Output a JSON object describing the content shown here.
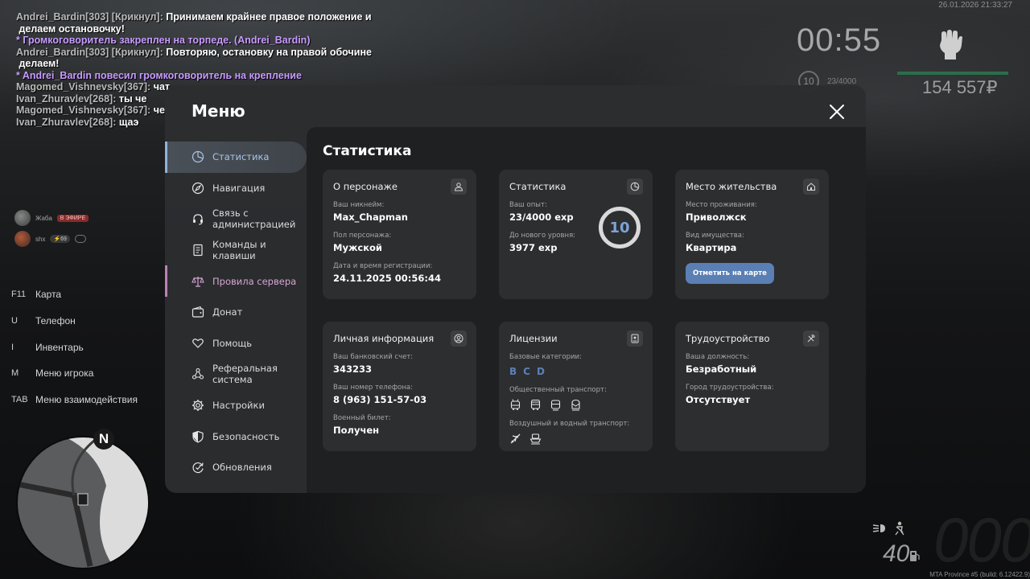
{
  "chat": [
    {
      "name": "Andrei_Bardin[303] [Крикнул]: ",
      "msg": "Принимаем крайнее правое положение и\n делаем остановочку!",
      "type": "msg"
    },
    {
      "name": "",
      "msg": "* Громкоговоритель закреплен на торпеде. (Andrei_Bardin)",
      "type": "act"
    },
    {
      "name": "Andrei_Bardin[303] [Крикнул]: ",
      "msg": "Повторяю, остановку на правой обочине\n делаем!",
      "type": "msg"
    },
    {
      "name": "",
      "msg": "* Andrei_Bardin повесил громкоговоритель на крепление",
      "type": "act"
    },
    {
      "name": "Magomed_Vishnevsky[367]: ",
      "msg": "чат",
      "type": "msg"
    },
    {
      "name": "Ivan_Zhuravlev[268]: ",
      "msg": "ты че",
      "type": "msg"
    },
    {
      "name": "Magomed_Vishnevsky[367]: ",
      "msg": "че",
      "type": "msg"
    },
    {
      "name": "Ivan_Zhuravlev[268]: ",
      "msg": "щаэ",
      "type": "msg"
    }
  ],
  "hud": {
    "datetime": "26.01.2026 21:33:27",
    "clock": "00:55",
    "level": "10",
    "exp": "23/4000",
    "money": "154 557₽",
    "health_fraction": 1.0,
    "fuel": "40",
    "speed": "000",
    "build": "MTA Province #5 (build: 6.12422.9)"
  },
  "voice": [
    {
      "name": "Жаба",
      "badge": "В ЭФИРЕ"
    },
    {
      "name": "shx",
      "badge": "⚡69"
    }
  ],
  "hotkeys": [
    {
      "key": "F11",
      "label": "Карта"
    },
    {
      "key": "U",
      "label": "Телефон"
    },
    {
      "key": "I",
      "label": "Инвентарь"
    },
    {
      "key": "M",
      "label": "Меню игрока"
    },
    {
      "key": "TAB",
      "label": "Меню взаимодействия"
    }
  ],
  "minimap": {
    "north": "N"
  },
  "menu": {
    "title": "Меню",
    "content_title": "Статистика",
    "nav": [
      {
        "label": "Статистика",
        "icon": "pie-chart-icon"
      },
      {
        "label": "Навигация",
        "icon": "compass-icon"
      },
      {
        "label": "Связь с администрацией",
        "icon": "headset-icon"
      },
      {
        "label": "Команды и клавиши",
        "icon": "document-icon"
      },
      {
        "label": "Провила сервера",
        "icon": "scales-icon"
      },
      {
        "label": "Донат",
        "icon": "wallet-icon"
      },
      {
        "label": "Помощь",
        "icon": "heart-hands-icon"
      },
      {
        "label": "Реферальная система",
        "icon": "network-icon"
      },
      {
        "label": "Настройки",
        "icon": "gear-icon"
      },
      {
        "label": "Безопасность",
        "icon": "shield-icon"
      },
      {
        "label": "Обновления",
        "icon": "refresh-check-icon"
      }
    ],
    "cards": {
      "character": {
        "title": "О персонаже",
        "fields": [
          {
            "label": "Ваш никнейм:",
            "value": "Max_Chapman"
          },
          {
            "label": "Пол персонажа:",
            "value": "Мужской"
          },
          {
            "label": "Дата и время регистрации:",
            "value": "24.11.2025 00:56:44"
          }
        ]
      },
      "stats": {
        "title": "Статистика",
        "fields": [
          {
            "label": "Ваш опыт:",
            "value": "23/4000 exp"
          },
          {
            "label": "До нового уровня:",
            "value": "3977 exp"
          }
        ],
        "level": "10"
      },
      "residence": {
        "title": "Место жительства",
        "fields": [
          {
            "label": "Место проживания:",
            "value": "Приволжск"
          },
          {
            "label": "Вид имущества:",
            "value": "Квартира"
          }
        ],
        "button": "Отметить на карте"
      },
      "personal": {
        "title": "Личная информация",
        "fields": [
          {
            "label": "Ваш банковский счет:",
            "value": "343233"
          },
          {
            "label": "Ваш номер телефона:",
            "value": "8 (963) 151-57-03"
          },
          {
            "label": "Военный билет:",
            "value": "Получен"
          }
        ]
      },
      "licenses": {
        "title": "Лицензии",
        "base_label": "Базовые категории:",
        "categories": [
          "B",
          "C",
          "D"
        ],
        "public_label": "Общественный транспорт:",
        "air_label": "Воздушный и водный транспорт:"
      },
      "employment": {
        "title": "Трудоустройство",
        "fields": [
          {
            "label": "Ваша должность:",
            "value": "Безработный"
          },
          {
            "label": "Город трудоустройства:",
            "value": "Отсутствует"
          }
        ]
      }
    }
  },
  "colors": {
    "accent": "#5a7fb4",
    "active_nav": "#a9c4e6",
    "rules_nav": "#d7a6d6",
    "chat_action": "#c99bff"
  }
}
